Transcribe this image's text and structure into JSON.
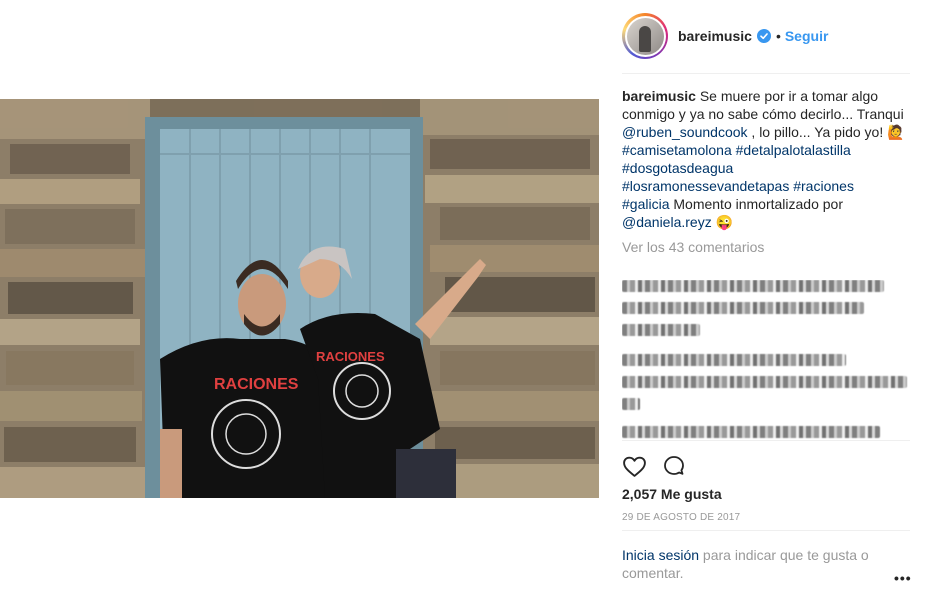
{
  "post": {
    "username": "bareimusic",
    "follow_label": "Seguir",
    "separator": "•",
    "caption_intro": "Se muere por ir a tomar algo conmigo y ya no sabe cómo decirlo... Tranqui ",
    "mention_1": "@ruben_soundcook",
    "caption_mid": " , lo pillo... Ya pido yo! 🙋",
    "hashtags": [
      "#camisetamolona",
      "#detalpalotalastilla",
      "#dosgotasdeagua",
      "#losramonessevandetapas",
      "#raciones",
      "#galicia"
    ],
    "caption_end": " Momento inmortalizado por ",
    "mention_2": "@daniela.reyz",
    "caption_emoji": " 😜",
    "view_comments": "Ver los 43 comentarios",
    "likes": "2,057 Me gusta",
    "date": "29 DE AGOSTO DE 2017",
    "login_link": "Inicia sesión",
    "login_text": " para indicar que te gusta o comentar.",
    "more_label": "•••"
  },
  "photo": {
    "shirt_text_left": "RACIONES",
    "shirt_text_right": "RACIONES"
  },
  "icons": {
    "verified": "verified-badge-icon",
    "like": "heart-outline-icon",
    "comment": "comment-bubble-icon"
  },
  "colors": {
    "link": "#003569",
    "follow": "#3897f0",
    "verified": "#3897f0",
    "muted": "#999999",
    "door": "#7fa4b4"
  }
}
